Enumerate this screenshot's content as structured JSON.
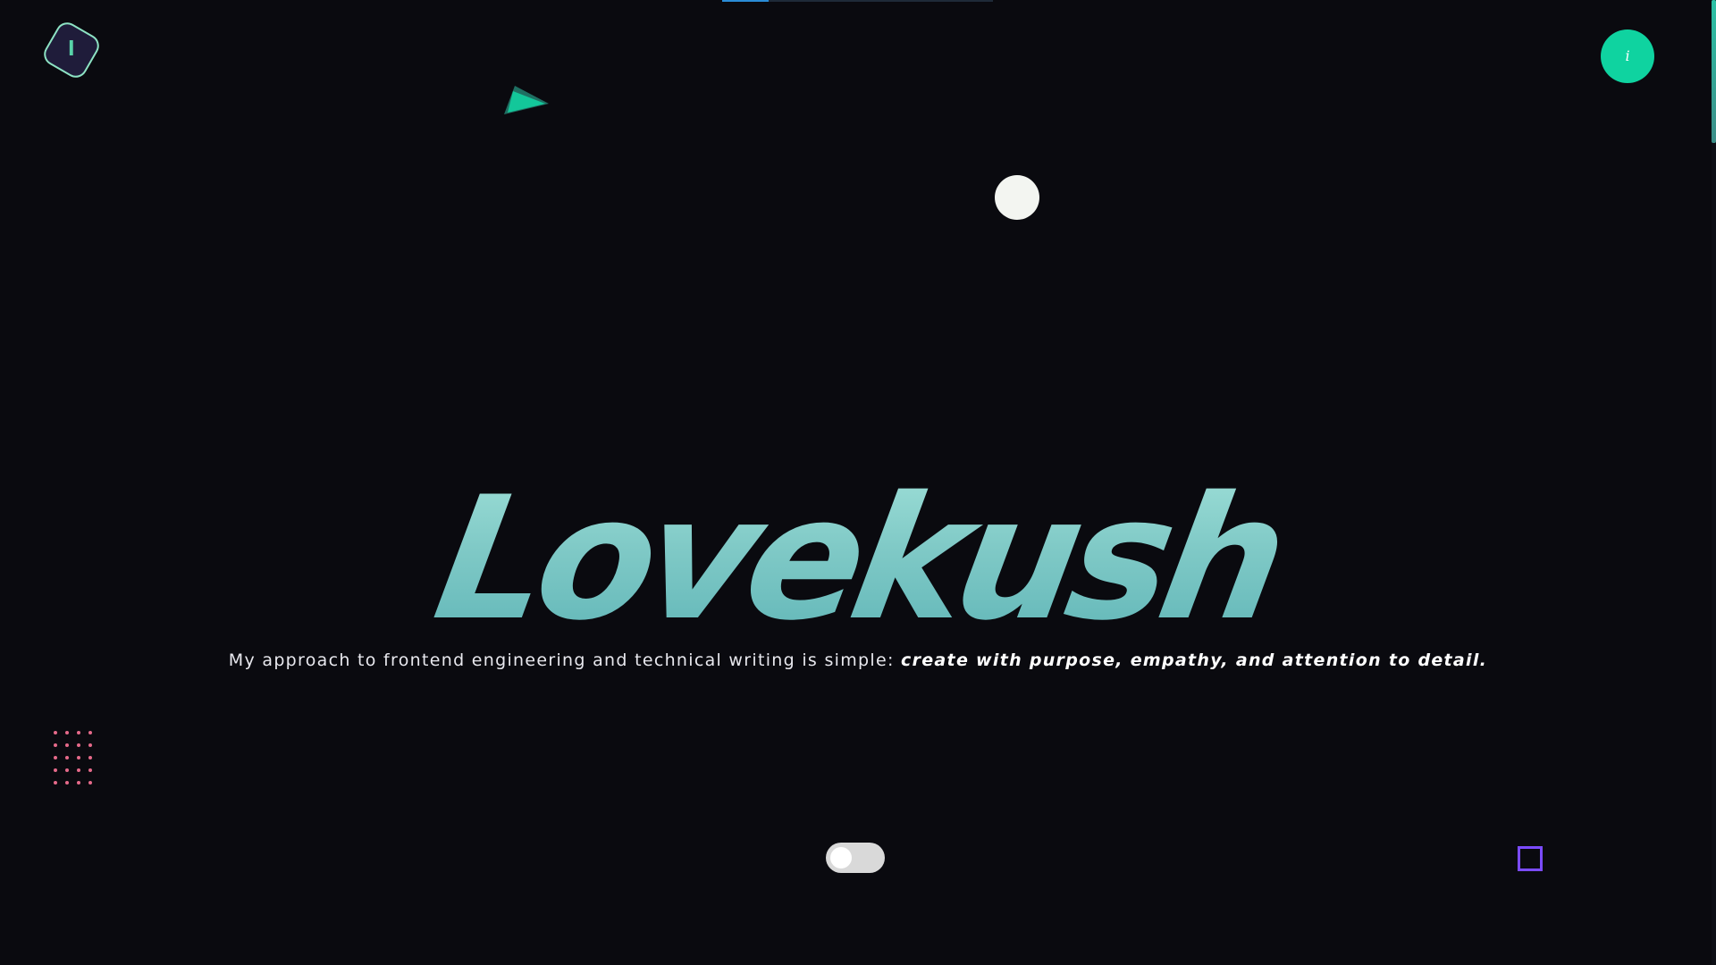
{
  "header": {
    "logo_letter": "l",
    "info_glyph": "i"
  },
  "top_progress": {
    "fraction": 0.17
  },
  "hero": {
    "name": "Lovekush",
    "tagline_plain": "My approach to frontend engineering and technical writing is simple: ",
    "tagline_emphasis": "create with purpose, empathy, and attention to detail."
  },
  "theme_toggle": {
    "state": "off"
  },
  "icons": {
    "logo": "logo-icon",
    "info": "info-icon",
    "triangle": "triangle-shape",
    "circle": "circle-shape",
    "dots": "dot-grid-shape",
    "square": "square-outline-shape"
  },
  "colors": {
    "background": "#0a0a0f",
    "accent": "#0fd3a0",
    "title_gradient_top": "#9fe0d8",
    "title_gradient_bottom": "#5db4b6",
    "dots": "#e66a8a",
    "square": "#7b4bff",
    "progress": "#2a8cd6"
  }
}
